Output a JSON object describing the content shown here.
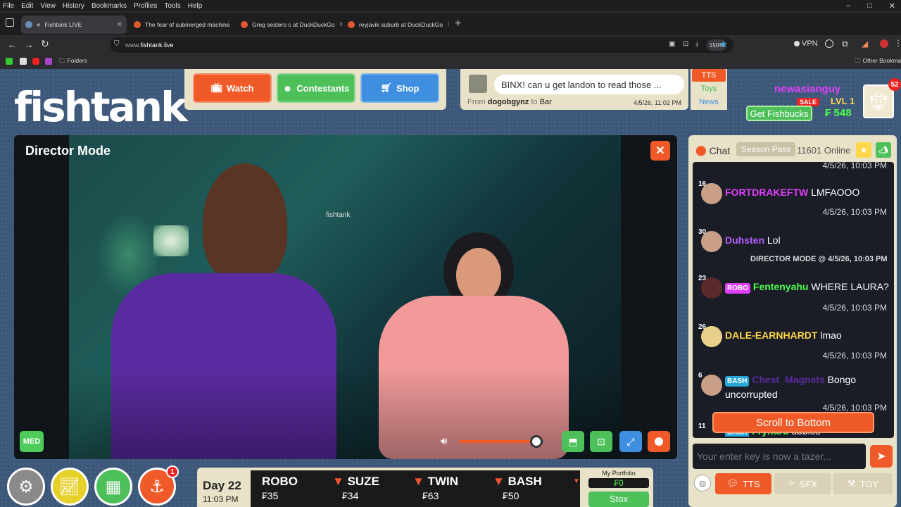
{
  "menu": [
    "File",
    "Edit",
    "View",
    "History",
    "Bookmarks",
    "Profiles",
    "Tools",
    "Help"
  ],
  "window_controls": [
    "–",
    "□",
    "✕"
  ],
  "tabs": [
    {
      "label": "Fishtank LIVE",
      "active": true
    },
    {
      "label": "The fear of submerged machine",
      "active": false
    },
    {
      "label": "Greg sestero c at DuckDuckGo",
      "active": false
    },
    {
      "label": "reyjavik suburb at DuckDuckGo",
      "active": false
    }
  ],
  "new_tab": "+",
  "url": {
    "prefix": "www.",
    "domain": "fishtank.live"
  },
  "zoom": "150%",
  "vpn": "VPN",
  "bookmarks": {
    "folders": "Folders",
    "other": "Other Bookmar"
  },
  "site": {
    "logo": "fishtank",
    "logo_mark": "©",
    "nav": {
      "watch": "Watch",
      "contestants": "Contestants",
      "shop": "Shop"
    },
    "message": {
      "text": "BINX! can u get landon to read those ...",
      "from_label": "From",
      "from_user": "dogobgynz",
      "to_label": "to",
      "to_user": "Bar",
      "time": "4/5/26, 11:02 PM"
    },
    "side_tabs": [
      "TTS",
      "Toys",
      "News"
    ],
    "user": {
      "name": "newasianguy",
      "sale": "SALE",
      "level": "LVL 1",
      "fishbucks_label": "Get Fishbucks",
      "balance": "₣ 548",
      "notif": "52"
    }
  },
  "video": {
    "mode": "Director Mode",
    "close": "✕",
    "quality": "MED",
    "volume_level": 0.9
  },
  "bottom": {
    "notif_count": "1",
    "day": "Day 22",
    "time": "11:03 PM",
    "stocks": [
      {
        "name": "ROBO",
        "value": "₣35",
        "down": false
      },
      {
        "name": "SUZE",
        "value": "₣34",
        "down": true
      },
      {
        "name": "TWIN",
        "value": "₣63",
        "down": true
      },
      {
        "name": "BASH",
        "value": "₣50",
        "down": true
      }
    ],
    "portfolio": {
      "label": "My Portfolio",
      "value": "₣0",
      "button": "Stox"
    }
  },
  "chat": {
    "title": "Chat",
    "season_pass": "Season Pass",
    "online": "11601 Online",
    "top_time": "4/5/26, 10:03 PM",
    "messages": [
      {
        "level": "16",
        "user": "FORTDRAKEFTW",
        "text": "LMFAOOO",
        "time": "4/5/26, 10:03 PM",
        "color": "#e040fb"
      },
      {
        "level": "30",
        "user": "Duhsten",
        "text": "Lol",
        "time": "4/5/26, 10:03 PM",
        "color": "#b060ff"
      },
      {
        "level": "23",
        "badge": "ROBO",
        "user": "Fentenyahu",
        "text": "WHERE LAURA?",
        "time": "4/5/26, 10:03 PM",
        "color": "#4dff4d"
      },
      {
        "level": "26",
        "user": "DALE-EARNHARDT",
        "text": "lmao",
        "time": "4/5/26, 10:03 PM",
        "color": "#ffd84a"
      },
      {
        "level": "6",
        "badge": "BASH",
        "user": "Chest_Magnets",
        "text": "Bongo uncorrupted",
        "time": "4/5/26, 10:03 PM",
        "color": "#5a2a9a"
      }
    ],
    "director_note": "DIRECTOR MODE @ 4/5/26, 10:03 PM",
    "partial": {
      "level": "11",
      "badge": "BASH",
      "user": "Frynard",
      "text": "ubbies"
    },
    "scroll_bottom": "Scroll to Bottom",
    "input_placeholder": "Your enter key is now a tazer...",
    "buttons": {
      "tts": "TTS",
      "sfx": "SFX",
      "toy": "TOY"
    }
  }
}
